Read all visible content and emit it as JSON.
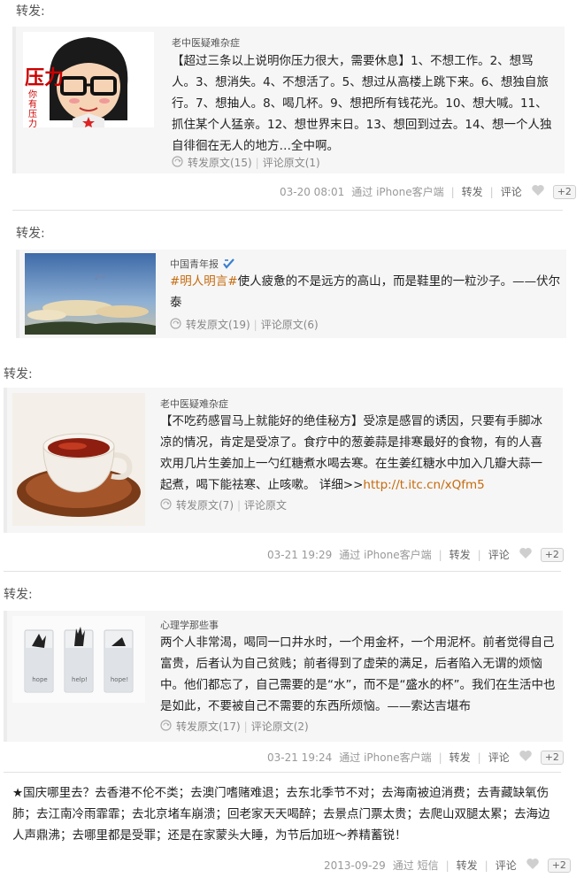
{
  "posts": [
    {
      "repost_label": "转发:",
      "author": "老中医疑难杂症",
      "text": "【超过三条以上说明你压力很大，需要休息】1、不想工作。2、想骂人。3、想消失。4、不想活了。5、想过从高楼上跳下来。6、想独自旅行。7、想抽人。8、喝几杯。9、想把所有钱花光。10、想大喊。11、抓住某个人猛亲。12、想世界末日。13、想回到过去。14、想一个人独自徘徊在无人的地方…全中啊。",
      "image_caption": "压力",
      "image_sub": "你有压力",
      "repost_original": "转发原文(15)",
      "comment_original": "评论原文(1)",
      "time": "03-20 08:01",
      "source": "通过 iPhone客户端",
      "repost": "转发",
      "comment": "评论",
      "plus": "+2"
    },
    {
      "repost_label": "转发:",
      "author": "中国青年报",
      "text_topic": "#明人明言#",
      "text": "使人疲惫的不是远方的高山，而是鞋里的一粒沙子。——伏尔泰",
      "repost_original": "转发原文(19)",
      "comment_original": "评论原文(6)"
    },
    {
      "repost_label": "转发:",
      "author": "老中医疑难杂症",
      "text": "【不吃药感冒马上就能好的绝佳秘方】受凉是感冒的诱因，只要有手脚冰凉的情况，肯定是受凉了。食疗中的葱姜蒜是排寒最好的食物，有的人喜欢用几片生姜加上一勺红糖煮水喝去寒。在生姜红糖水中加入几瓣大蒜一起煮，喝下能祛寒、止咳嗽。 详细>>",
      "link": "http://t.itc.cn/xQfm5",
      "repost_original": "转发原文(7)",
      "comment_original": "评论原文",
      "time": "03-21 19:29",
      "source": "通过 iPhone客户端",
      "repost": "转发",
      "comment": "评论",
      "plus": "+2"
    },
    {
      "repost_label": "转发:",
      "author": "心理学那些事",
      "text": "两个人非常渴，喝同一口井水时，一个用金杯，一个用泥杯。前者觉得自己富贵，后者认为自己贫贱；前者得到了虚荣的满足，后者陷入无谓的烦恼中。他们都忘了，自己需要的是“水”，而不是“盛水的杯”。我们在生活中也是如此，不要被自己不需要的东西所烦恼。——索达吉堪布",
      "glass_labels": [
        "hope",
        "help!",
        "hope!"
      ],
      "repost_original": "转发原文(17)",
      "comment_original": "评论原文(2)",
      "time": "03-21 19:24",
      "source": "通过 iPhone客户端",
      "repost": "转发",
      "comment": "评论",
      "plus": "+2"
    },
    {
      "text": "★国庆哪里去？去香港不伦不类；去澳门嗜赌难退；去东北季节不对；去海南被迫消费；去青藏缺氧伤肺；去江南冷雨霏霏；去北京堵车崩溃；回老家天天喝醉；去景点门票太贵；去爬山双腿太累；去海边人声鼎沸；去哪里都是受罪；还是在家蒙头大睡，为节后加班～养精蓄锐！",
      "time": "2013-09-29",
      "source": "通过 短信",
      "repost": "转发",
      "comment": "评论",
      "plus": "+2"
    }
  ],
  "colors": {
    "link": "#c66a0c",
    "card_bg": "#f6f6f6",
    "meta": "#999999"
  },
  "icons": [
    "repost-icon",
    "heart-icon",
    "verified-badge-icon"
  ]
}
